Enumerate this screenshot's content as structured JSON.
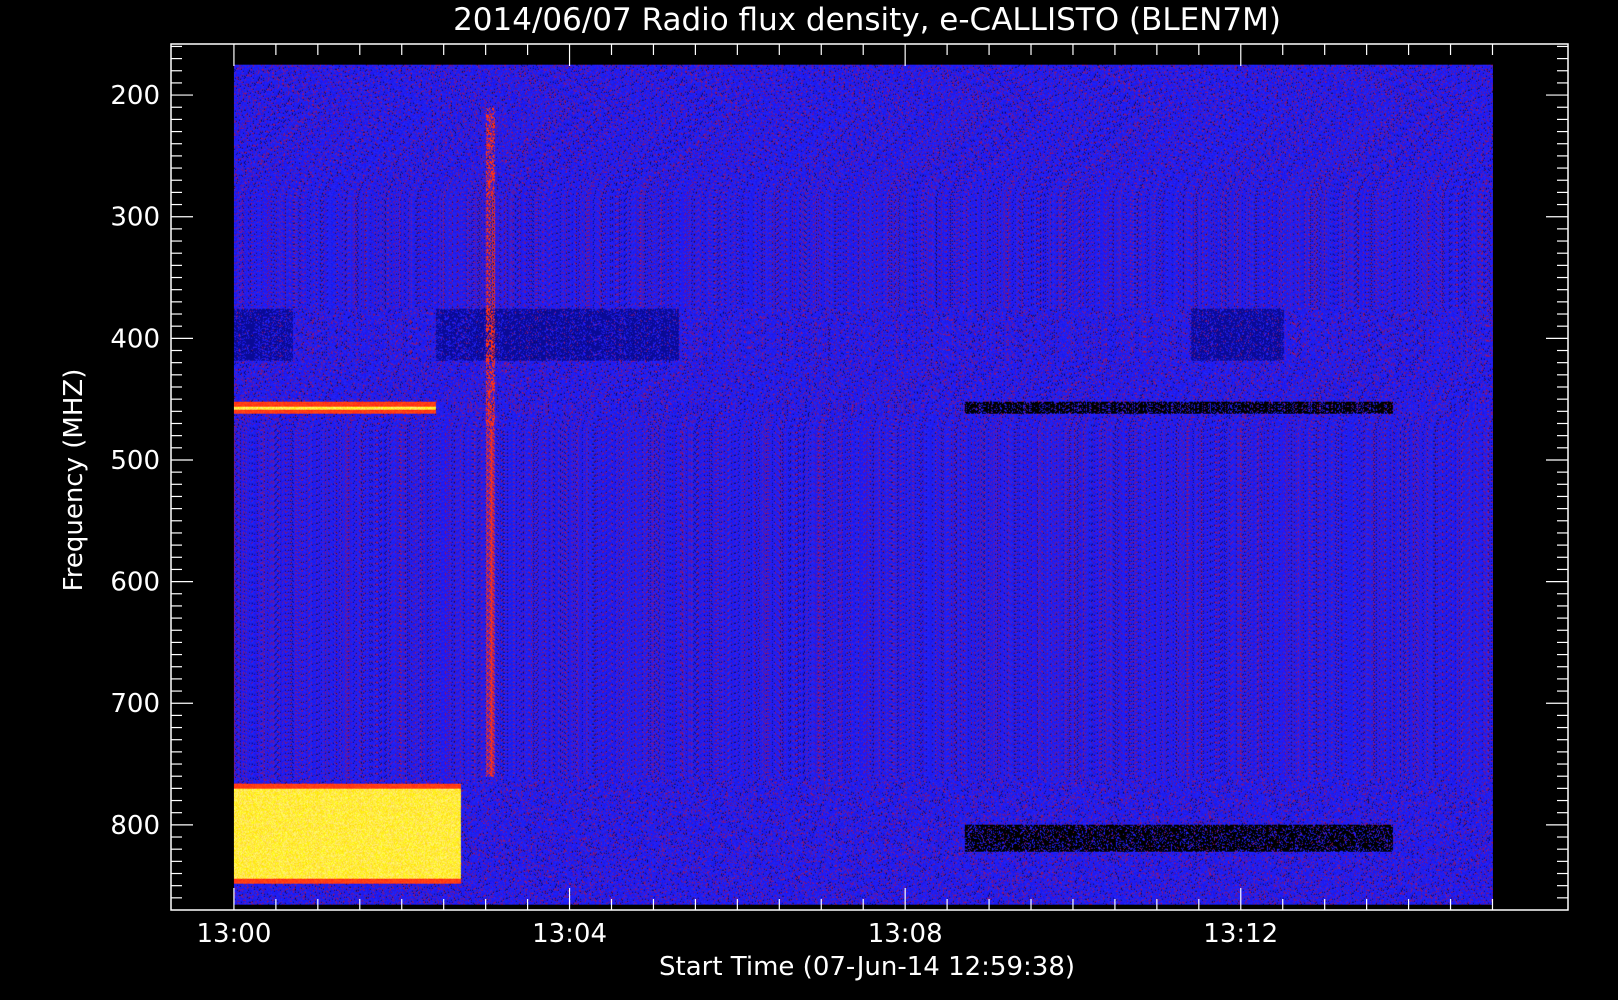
{
  "chart_data": {
    "type": "heatmap",
    "title": "2014/06/07  Radio flux density, e-CALLISTO (BLEN7M)",
    "xlabel": "Start Time (07-Jun-14 12:59:38)",
    "ylabel": "Frequency (MHZ)",
    "x_ticks": [
      "13:00",
      "13:04",
      "13:08",
      "13:12"
    ],
    "x_tick_minutes": [
      0,
      4,
      8,
      12
    ],
    "y_ticks": [
      200,
      300,
      400,
      500,
      600,
      700,
      800
    ],
    "xlim_minutes": [
      -0.75,
      15.9
    ],
    "data_xlim_minutes": [
      0,
      15
    ],
    "ylim": [
      870,
      158
    ],
    "data_ylim": [
      866,
      175
    ],
    "grid": false,
    "colors": {
      "background": "#000000",
      "low": "#1a1ae6",
      "mid": "#8a1a6a",
      "high": "#ff3010",
      "peak": "#ffff80"
    },
    "features": [
      {
        "name": "bright band",
        "t_start": 0,
        "t_end": 2.7,
        "f_start": 766,
        "f_end": 848,
        "level": "peak"
      },
      {
        "name": "bright line",
        "t_start": 0,
        "t_end": 2.4,
        "f_start": 452,
        "f_end": 462,
        "level": "peak"
      },
      {
        "name": "dark band",
        "t_start": 0,
        "t_end": 0.7,
        "f_start": 375,
        "f_end": 418,
        "level": "dark"
      },
      {
        "name": "dark band",
        "t_start": 2.4,
        "t_end": 5.3,
        "f_start": 375,
        "f_end": 418,
        "level": "dark"
      },
      {
        "name": "dark band",
        "t_start": 11.4,
        "t_end": 12.5,
        "f_start": 375,
        "f_end": 418,
        "level": "dark"
      },
      {
        "name": "dark line",
        "t_start": 8.7,
        "t_end": 13.8,
        "f_start": 452,
        "f_end": 462,
        "level": "black"
      },
      {
        "name": "dark band",
        "t_start": 8.7,
        "t_end": 13.8,
        "f_start": 800,
        "f_end": 822,
        "level": "black"
      },
      {
        "name": "burst",
        "t_start": 3.0,
        "t_end": 3.1,
        "f_start": 210,
        "f_end": 760,
        "level": "high"
      }
    ]
  }
}
